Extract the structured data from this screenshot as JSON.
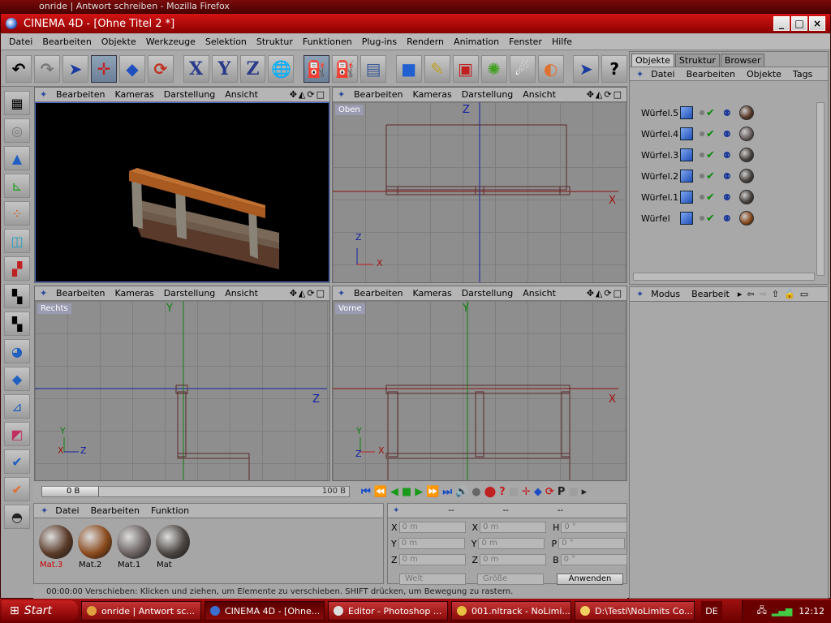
{
  "firefox_title": "onride | Antwort schreiben - Mozilla Firefox",
  "window": {
    "title": "CINEMA 4D - [Ohne Titel 2 *]",
    "minimize": "_",
    "maximize": "□",
    "close": "×"
  },
  "menu": [
    "Datei",
    "Bearbeiten",
    "Objekte",
    "Werkzeuge",
    "Selektion",
    "Struktur",
    "Funktionen",
    "Plug-ins",
    "Rendern",
    "Animation",
    "Fenster",
    "Hilfe"
  ],
  "viewport_menu": [
    "Bearbeiten",
    "Kameras",
    "Darstellung",
    "Ansicht"
  ],
  "viewports": {
    "perspective": {
      "label": ""
    },
    "top": {
      "label": "Oben"
    },
    "right": {
      "label": "Rechts"
    },
    "front": {
      "label": "Vorne"
    }
  },
  "axes": {
    "x": "X",
    "y": "Y",
    "z": "Z"
  },
  "timeline": {
    "current": "0 B",
    "end": "100 B"
  },
  "material_menu": [
    "Datei",
    "Bearbeiten",
    "Funktion"
  ],
  "materials": [
    {
      "name": "Mat.3",
      "color": "#5a3a28",
      "active": true
    },
    {
      "name": "Mat.2",
      "color": "#8a4a1c",
      "active": false
    },
    {
      "name": "Mat.1",
      "color": "#6a6060",
      "active": false
    },
    {
      "name": "Mat",
      "color": "#4a4440",
      "active": false
    }
  ],
  "coords": {
    "head": [
      "--",
      "--",
      "--"
    ],
    "rows": [
      {
        "a": "X",
        "av": "0 m",
        "b": "X",
        "bv": "0 m",
        "c": "H",
        "cv": "0 °"
      },
      {
        "a": "Y",
        "av": "0 m",
        "b": "Y",
        "bv": "0 m",
        "c": "P",
        "cv": "0 °"
      },
      {
        "a": "Z",
        "av": "0 m",
        "b": "Z",
        "bv": "0 m",
        "c": "B",
        "cv": "0 °"
      }
    ],
    "world": "Welt",
    "size": "Größe",
    "apply": "Anwenden"
  },
  "status": "00:00:00  Verschieben: Klicken und ziehen, um Elemente zu verschieben. SHIFT drücken, um Bewegung zu rastern.",
  "objects_tabs": [
    "Objekte",
    "Struktur",
    "Browser"
  ],
  "objects_menu": [
    "Datei",
    "Bearbeiten",
    "Objekte",
    "Tags"
  ],
  "objects": [
    {
      "name": "Würfel.5",
      "mat": "#5a3a28"
    },
    {
      "name": "Würfel.4",
      "mat": "#6a6060"
    },
    {
      "name": "Würfel.3",
      "mat": "#4a4440"
    },
    {
      "name": "Würfel.2",
      "mat": "#4a4440"
    },
    {
      "name": "Würfel.1",
      "mat": "#4a4440"
    },
    {
      "name": "Würfel",
      "mat": "#8a4a1c"
    }
  ],
  "attr_menu": [
    "Modus",
    "Bearbeit"
  ],
  "taskbar": {
    "start": "Start",
    "tasks": [
      "onride | Antwort sc...",
      "CINEMA 4D - [Ohne...",
      "Editor - Photoshop ...",
      "001.nltrack - NoLimi...",
      "D:\\Testi\\NoLimits Co..."
    ],
    "lang": "DE",
    "time": "12:12"
  }
}
